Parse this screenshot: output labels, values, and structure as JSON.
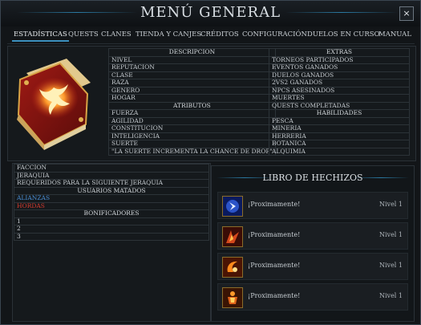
{
  "window": {
    "title": "MENÚ GENERAL",
    "close_label": "×"
  },
  "tabs": [
    {
      "label": "ESTADÍSTICAS"
    },
    {
      "label": "QUESTS"
    },
    {
      "label": "CLANES"
    },
    {
      "label": "TIENDA Y CANJES"
    },
    {
      "label": "CRÉDITOS"
    },
    {
      "label": "CONFIGURACIÓN"
    },
    {
      "label": "DUELOS EN CURSO"
    },
    {
      "label": "MANUAL"
    }
  ],
  "left_table": {
    "header": "DESCRIPCIÓN",
    "rows": [
      "NIVEL",
      "REPUTACIÓN",
      "CLASE",
      "RAZA",
      "GÉNERO",
      "HOGAR"
    ],
    "attributes_header": "ATRIBUTOS",
    "attributes": [
      "FUERZA",
      "AGILIDAD",
      "CONSTITUCIÓN",
      "INTELIGENCIA",
      "SUERTE"
    ],
    "note": "\"LA SUERTE INCREMENTA LA CHANCE DE DROP\""
  },
  "right_table": {
    "header": "EXTRAS",
    "rows": [
      "TORNEOS PARTICIPADOS",
      "EVENTOS GANADOS",
      "DUELOS GANADOS",
      "2VS2 GANADOS",
      "NPCS ASESINADOS",
      "MUERTES",
      "QUESTS COMPLETADAS"
    ],
    "skills_header": "HABILIDADES",
    "skills": [
      "PESCA",
      "MINERÍA",
      "HERRERÍA",
      "BOTÁNICA",
      "ALQUIMIA"
    ]
  },
  "lower_table": {
    "rows": [
      "FACCIÓN",
      "JERAQUÍA",
      "REQUERIDOS PARA LA SIGUIENTE JERAQUÍA"
    ],
    "killed_header": "USUARIOS MATADOS",
    "alliances": "ALIANZAS",
    "hordes": "HORDAS",
    "bonus_header": "BONIFICADORES",
    "bonus_rows": [
      "1",
      "2",
      "3"
    ]
  },
  "spellbook": {
    "title": "LIBRO DE HECHIZOS",
    "spells": [
      {
        "name": "¡Proximamente!",
        "level": "Nivel 1",
        "icon": "blue-rune-icon"
      },
      {
        "name": "¡Proximamente!",
        "level": "Nivel 1",
        "icon": "fire-claw-icon"
      },
      {
        "name": "¡Proximamente!",
        "level": "Nivel 1",
        "icon": "flame-arc-icon"
      },
      {
        "name": "¡Proximamente!",
        "level": "Nivel 1",
        "icon": "fire-golem-icon"
      }
    ]
  },
  "colors": {
    "accent": "#3b8fbd",
    "alliances": "#4a8fd6",
    "hordes": "#d63a2e"
  }
}
